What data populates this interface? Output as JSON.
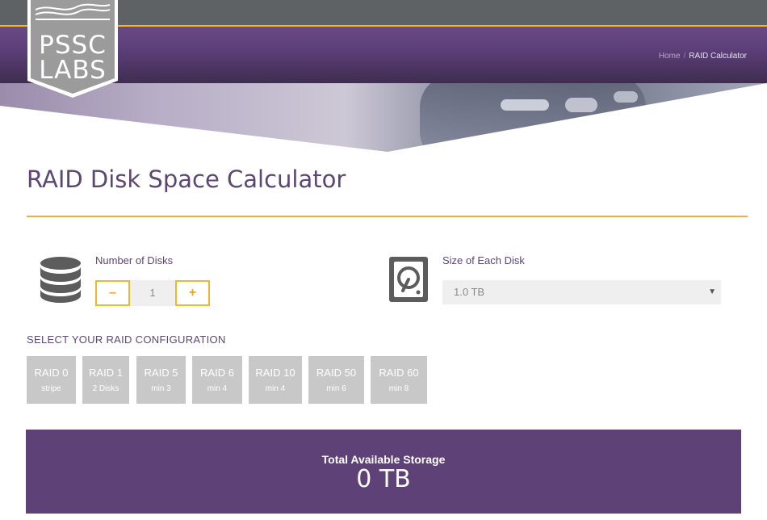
{
  "logo": {
    "line1": "PSSC",
    "line2": "LABS"
  },
  "breadcrumb": {
    "home": "Home",
    "separator": "/",
    "current": "RAID Calculator"
  },
  "page": {
    "title": "RAID Disk Space Calculator"
  },
  "disks": {
    "label": "Number of Disks",
    "minus": "–",
    "plus": "+",
    "value": "1",
    "icon": "database-icon"
  },
  "disk_size": {
    "label": "Size of Each Disk",
    "selected": "1.0 TB",
    "icon": "hard-drive-icon"
  },
  "raid": {
    "heading": "SELECT YOUR RAID CONFIGURATION",
    "options": [
      {
        "name": "RAID 0",
        "sub": "stripe"
      },
      {
        "name": "RAID 1",
        "sub": "2 Disks"
      },
      {
        "name": "RAID 5",
        "sub": "min 3"
      },
      {
        "name": "RAID 6",
        "sub": "min 4"
      },
      {
        "name": "RAID 10",
        "sub": "min 4"
      },
      {
        "name": "RAID 50",
        "sub": "min 6"
      },
      {
        "name": "RAID 60",
        "sub": "min 8"
      }
    ]
  },
  "result": {
    "label": "Total Available Storage",
    "value": "0 TB"
  },
  "colors": {
    "purple": "#5e4277",
    "gold": "#f0b72a",
    "button_grey": "#c8c8c8"
  }
}
